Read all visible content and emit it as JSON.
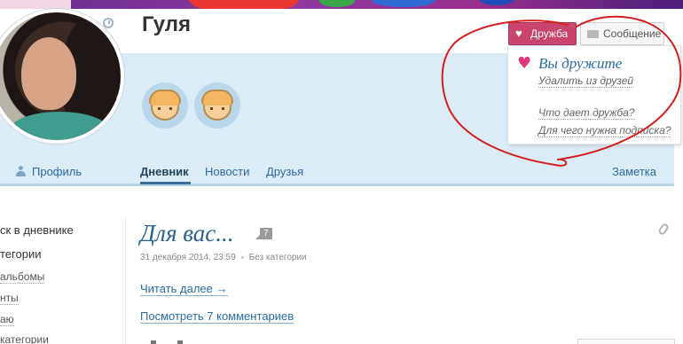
{
  "profile": {
    "username": "Гуля",
    "badges": [
      "girl-avatar-badge",
      "girl-avatar-badge"
    ]
  },
  "actions": {
    "friend_label": "Дружба",
    "message_label": "Сообщение"
  },
  "friendship_dropdown": {
    "status": "Вы дружите",
    "remove_label": "Удалить из друзей",
    "question_1": "Что дает дружба?",
    "question_2": "Для чего нужна подписка?"
  },
  "nav": {
    "profile_label": "Профиль",
    "tabs": [
      {
        "label": "Дневник",
        "active": true
      },
      {
        "label": "Новости",
        "active": false
      },
      {
        "label": "Друзья",
        "active": false
      }
    ],
    "note_label": "Заметка"
  },
  "sidebar": {
    "search_label": "ск в дневнике",
    "categories_label": "тегории",
    "links": [
      "альбомы",
      "нты",
      "аю",
      "категории"
    ]
  },
  "post": {
    "title": "Для вас...",
    "comment_count": "7",
    "date": "31 декабря 2014, 23:59",
    "category": "Без категории",
    "read_more": "Читать далее →",
    "view_comments": "Посмотреть 7 комментариев"
  },
  "colors": {
    "friend_button": "#c9456e",
    "link": "#2b6aa1",
    "header_band": "#dcecf7",
    "annotation": "#d3201f"
  }
}
